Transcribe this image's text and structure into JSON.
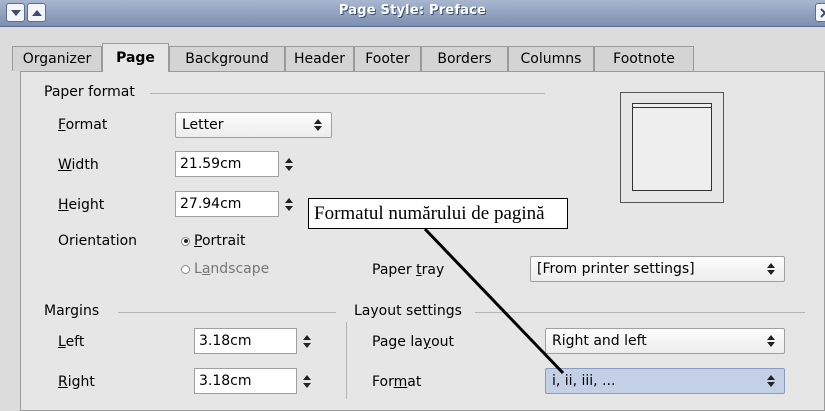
{
  "window": {
    "title": "Page Style: Preface"
  },
  "tabs": [
    "Organizer",
    "Page",
    "Background",
    "Header",
    "Footer",
    "Borders",
    "Columns",
    "Footnote"
  ],
  "active_tab": "Page",
  "paper_format": {
    "group_label": "Paper format",
    "format_label_pre": "",
    "format_label_u": "F",
    "format_label_post": "ormat",
    "format_value": "Letter",
    "width_label_u": "W",
    "width_label_post": "idth",
    "width_value": "21.59cm",
    "height_label_u": "H",
    "height_label_post": "eight",
    "height_value": "27.94cm",
    "orientation_label": "Orientation",
    "portrait_u": "P",
    "portrait_post": "ortrait",
    "landscape_pre": "L",
    "landscape_u": "a",
    "landscape_post": "ndscape",
    "paper_tray_pre": "Paper ",
    "paper_tray_u": "t",
    "paper_tray_post": "ray",
    "paper_tray_value": "[From printer settings]"
  },
  "margins": {
    "group_label": "Margins",
    "left_u": "L",
    "left_post": "eft",
    "left_value": "3.18cm",
    "right_u": "R",
    "right_post": "ight",
    "right_value": "3.18cm"
  },
  "layout": {
    "group_label": "Layout settings",
    "page_layout_pre": "Page la",
    "page_layout_u": "y",
    "page_layout_post": "out",
    "page_layout_value": "Right and left",
    "format_pre": "For",
    "format_u": "m",
    "format_post": "at",
    "format_value": "i, ii, iii, ..."
  },
  "annotation": {
    "text": "Formatul numărului de pagină"
  }
}
